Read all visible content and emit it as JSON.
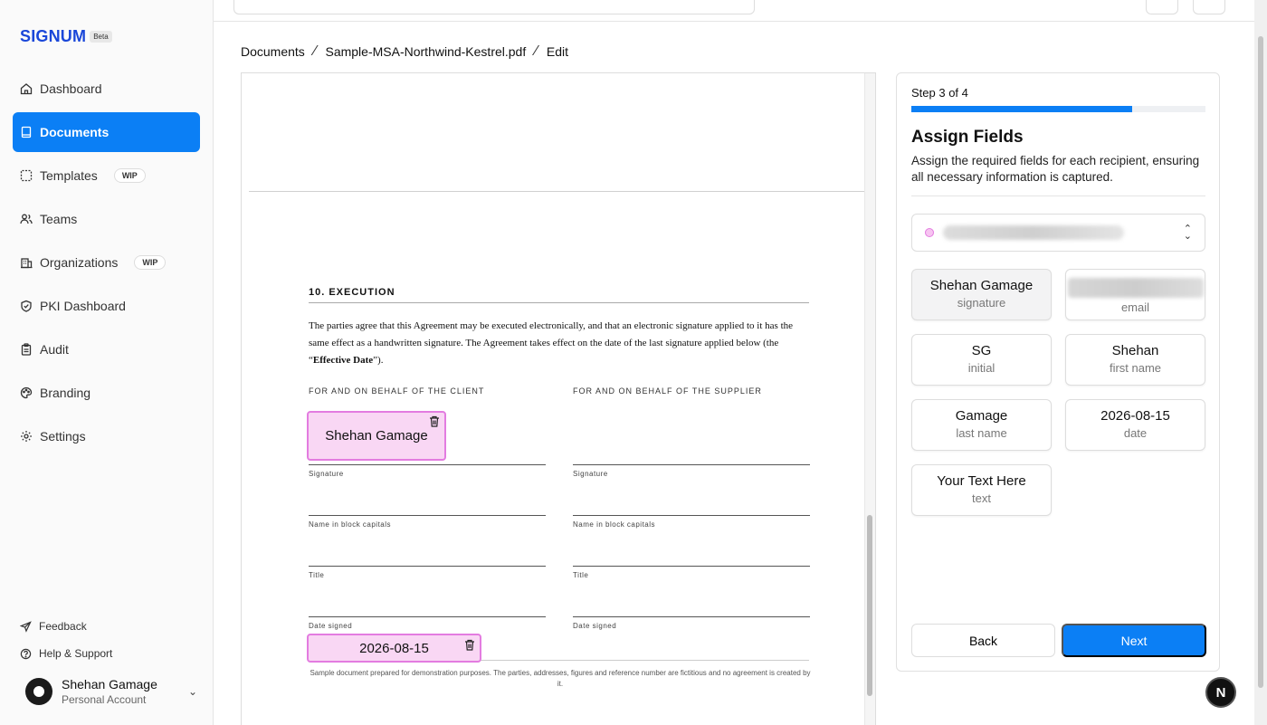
{
  "app": {
    "name": "SIGNUM",
    "badge": "Beta"
  },
  "sidebar": {
    "items": [
      {
        "label": "Dashboard",
        "icon": "home-icon"
      },
      {
        "label": "Documents",
        "icon": "document-icon",
        "active": true
      },
      {
        "label": "Templates",
        "icon": "template-icon",
        "badge": "WIP"
      },
      {
        "label": "Teams",
        "icon": "users-icon"
      },
      {
        "label": "Organizations",
        "icon": "building-icon",
        "badge": "WIP"
      },
      {
        "label": "PKI Dashboard",
        "icon": "shield-icon"
      },
      {
        "label": "Audit",
        "icon": "clipboard-icon"
      },
      {
        "label": "Branding",
        "icon": "palette-icon"
      },
      {
        "label": "Settings",
        "icon": "gear-icon"
      }
    ],
    "links": [
      {
        "label": "Feedback",
        "icon": "send-icon"
      },
      {
        "label": "Help & Support",
        "icon": "help-icon"
      }
    ],
    "account": {
      "name": "Shehan Gamage",
      "type": "Personal Account"
    }
  },
  "breadcrumb": [
    "Documents",
    "Sample-MSA-Northwind-Kestrel.pdf",
    "Edit"
  ],
  "document": {
    "section_title": "10. EXECUTION",
    "paragraph_pre": "The parties agree that this Agreement may be executed electronically, and that an electronic signature applied to it has the same effect as a handwritten signature. The Agreement takes effect on the date of the last signature applied below (the “",
    "paragraph_bold": "Effective Date",
    "paragraph_post": "”).",
    "client_heading": "FOR AND ON BEHALF OF THE CLIENT",
    "supplier_heading": "FOR AND ON BEHALF OF THE SUPPLIER",
    "labels": [
      "Signature",
      "Name in block capitals",
      "Title",
      "Date signed"
    ],
    "footer": "Sample document prepared for demonstration purposes. The parties, addresses, figures and reference number are fictitious and no agreement is created by it.",
    "placed_fields": {
      "signature": "Shehan Gamage",
      "date": "2026-08-15"
    }
  },
  "panel": {
    "step": "Step 3 of 4",
    "progress": 0.75,
    "title": "Assign Fields",
    "description": "Assign the required fields for each recipient, ensuring all necessary information is captured.",
    "fields": [
      {
        "value": "Shehan Gamage",
        "label": "signature",
        "selected": true
      },
      {
        "value": "",
        "label": "email",
        "blurred": true
      },
      {
        "value": "SG",
        "label": "initial"
      },
      {
        "value": "Shehan",
        "label": "first name"
      },
      {
        "value": "Gamage",
        "label": "last name"
      },
      {
        "value": "2026-08-15",
        "label": "date"
      },
      {
        "value": "Your Text Here",
        "label": "text"
      }
    ],
    "back": "Back",
    "next": "Next"
  },
  "colors": {
    "accent": "#0b7ff5",
    "brand": "#1a47d9",
    "field_bg": "#f9d7f4",
    "field_border": "#e37ce0"
  },
  "floating_badge": "N"
}
